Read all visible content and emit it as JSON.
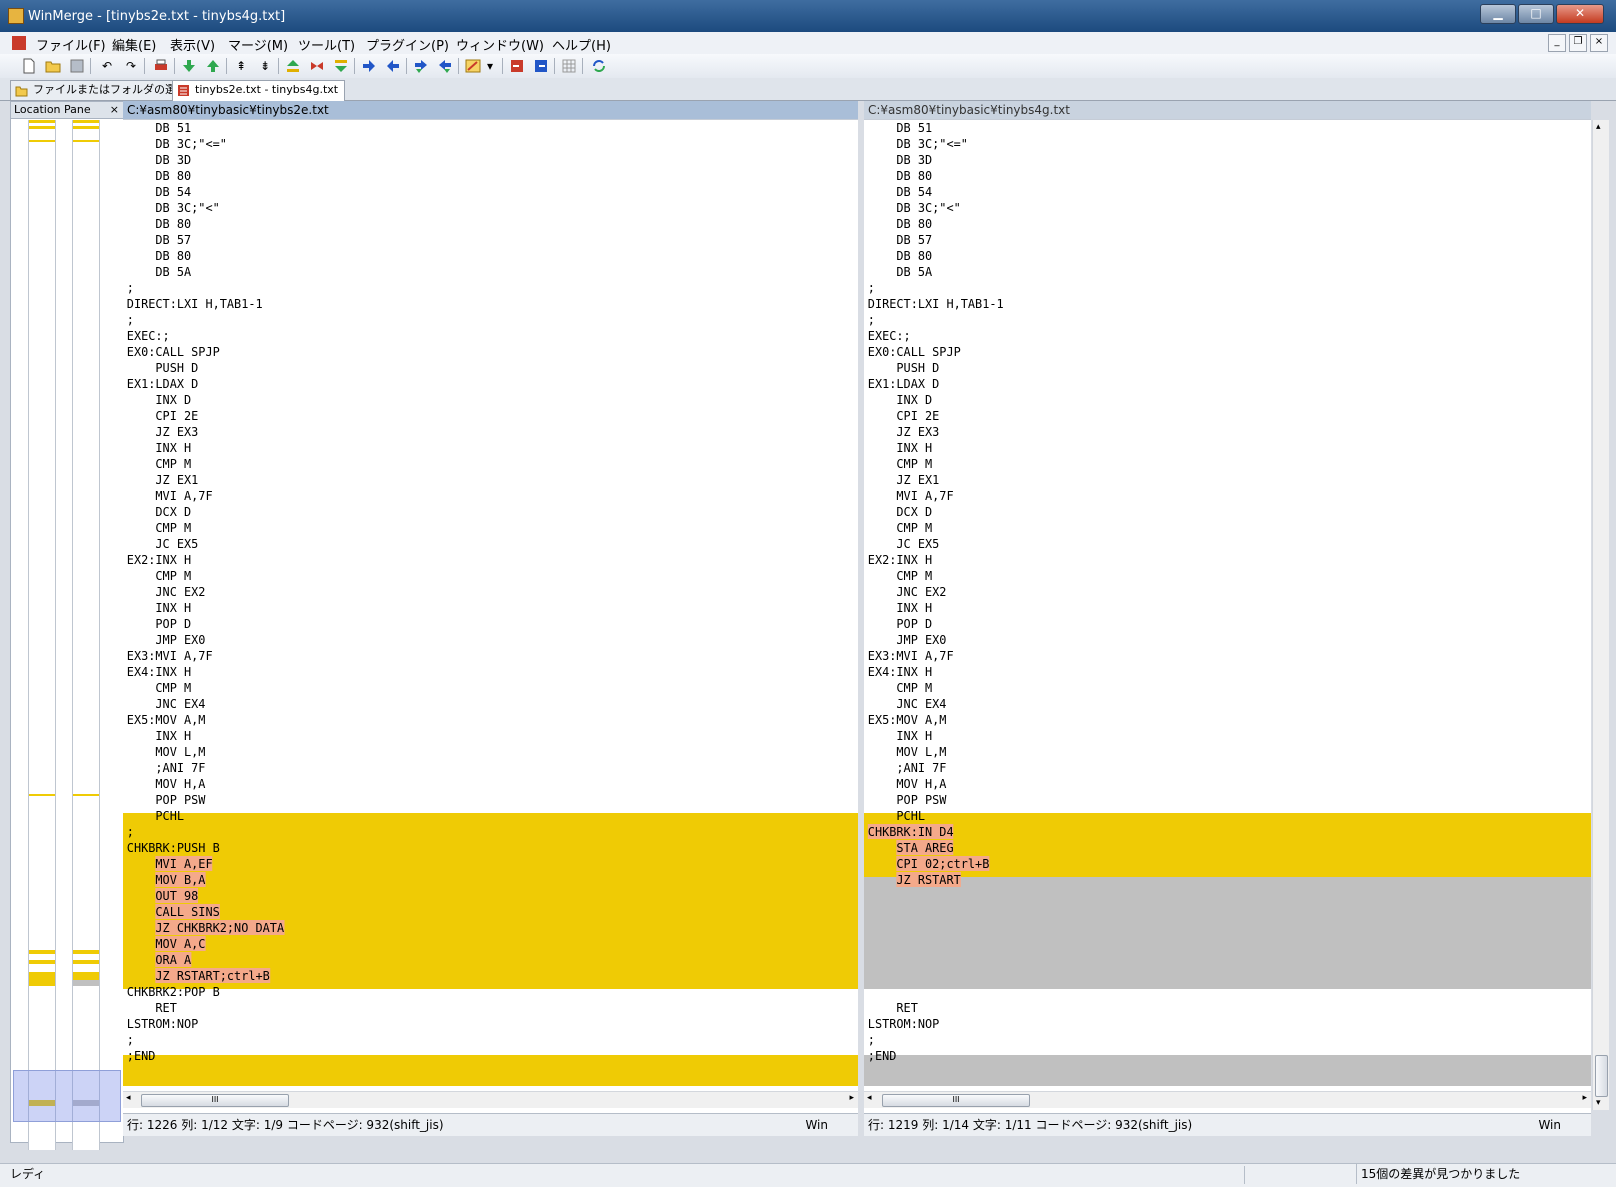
{
  "window": {
    "title": "WinMerge - [tinybs2e.txt - tinybs4g.txt]",
    "min": "▁",
    "max": "□",
    "close": "✕"
  },
  "menu": [
    "ファイル(F)",
    "編集(E)",
    "表示(V)",
    "マージ(M)",
    "ツール(T)",
    "プラグイン(P)",
    "ウィンドウ(W)",
    "ヘルプ(H)"
  ],
  "mdi": {
    "min": "_",
    "restore": "❐",
    "close": "×"
  },
  "tabs": [
    {
      "label": "ファイルまたはフォルダの選択..."
    },
    {
      "label": "tinybs2e.txt - tinybs4g.txt"
    }
  ],
  "location_pane": {
    "title": "Location Pane",
    "close": "×"
  },
  "left": {
    "path": "C:¥asm80¥tinybasic¥tinybs2e.txt",
    "lines": [
      "    DB 51",
      "    DB 3C;\"<=\"",
      "    DB 3D",
      "    DB 80",
      "    DB 54",
      "    DB 3C;\"<\"",
      "    DB 80",
      "    DB 57",
      "    DB 80",
      "    DB 5A",
      ";",
      "DIRECT:LXI H,TAB1-1",
      ";",
      "EXEC:;",
      "EX0:CALL SPJP",
      "    PUSH D",
      "EX1:LDAX D",
      "    INX D",
      "    CPI 2E",
      "    JZ EX3",
      "    INX H",
      "    CMP M",
      "    JZ EX1",
      "    MVI A,7F",
      "    DCX D",
      "    CMP M",
      "    JC EX5",
      "EX2:INX H",
      "    CMP M",
      "    JNC EX2",
      "    INX H",
      "    POP D",
      "    JMP EX0",
      "EX3:MVI A,7F",
      "EX4:INX H",
      "    CMP M",
      "    JNC EX4",
      "EX5:MOV A,M",
      "    INX H",
      "    MOV L,M",
      "    ;ANI 7F",
      "    MOV H,A",
      "    POP PSW",
      "    PCHL",
      ";",
      "CHKBRK:PUSH B",
      "    MVI A,EF",
      "    MOV B,A",
      "    OUT 98",
      "    CALL SINS",
      "    JZ CHKBRK2;NO DATA",
      "    MOV A,C",
      "    ORA A",
      "    JZ RSTART;ctrl+B",
      "CHKBRK2:POP B",
      "    RET",
      "LSTROM:NOP",
      ";",
      ";END"
    ],
    "status": "行: 1226  列: 1/12  文字: 1/9  コードページ: 932(shift_jis)",
    "eol": "Win"
  },
  "right": {
    "path": "C:¥asm80¥tinybasic¥tinybs4g.txt",
    "lines": [
      "    DB 51",
      "    DB 3C;\"<=\"",
      "    DB 3D",
      "    DB 80",
      "    DB 54",
      "    DB 3C;\"<\"",
      "    DB 80",
      "    DB 57",
      "    DB 80",
      "    DB 5A",
      ";",
      "DIRECT:LXI H,TAB1-1",
      ";",
      "EXEC:;",
      "EX0:CALL SPJP",
      "    PUSH D",
      "EX1:LDAX D",
      "    INX D",
      "    CPI 2E",
      "    JZ EX3",
      "    INX H",
      "    CMP M",
      "    JZ EX1",
      "    MVI A,7F",
      "    DCX D",
      "    CMP M",
      "    JC EX5",
      "EX2:INX H",
      "    CMP M",
      "    JNC EX2",
      "    INX H",
      "    POP D",
      "    JMP EX0",
      "EX3:MVI A,7F",
      "EX4:INX H",
      "    CMP M",
      "    JNC EX4",
      "EX5:MOV A,M",
      "    INX H",
      "    MOV L,M",
      "    ;ANI 7F",
      "    MOV H,A",
      "    POP PSW",
      "    PCHL",
      "CHKBRK:IN D4",
      "    STA AREG",
      "    CPI 02;ctrl+B",
      "    JZ RSTART",
      "",
      "",
      "",
      "",
      "",
      "",
      "",
      "    RET",
      "LSTROM:NOP",
      ";",
      ";END"
    ],
    "status": "行: 1219  列: 1/14  文字: 1/11  コードページ: 932(shift_jis)",
    "eol": "Win"
  },
  "statusbar": {
    "left": "レディ",
    "right": "15個の差異が見つかりました"
  },
  "colors": {
    "diff": "#efcb05",
    "word_diff": "#f4a98a",
    "missing": "#c0c0c0"
  },
  "scroll_thumb_label": "III"
}
